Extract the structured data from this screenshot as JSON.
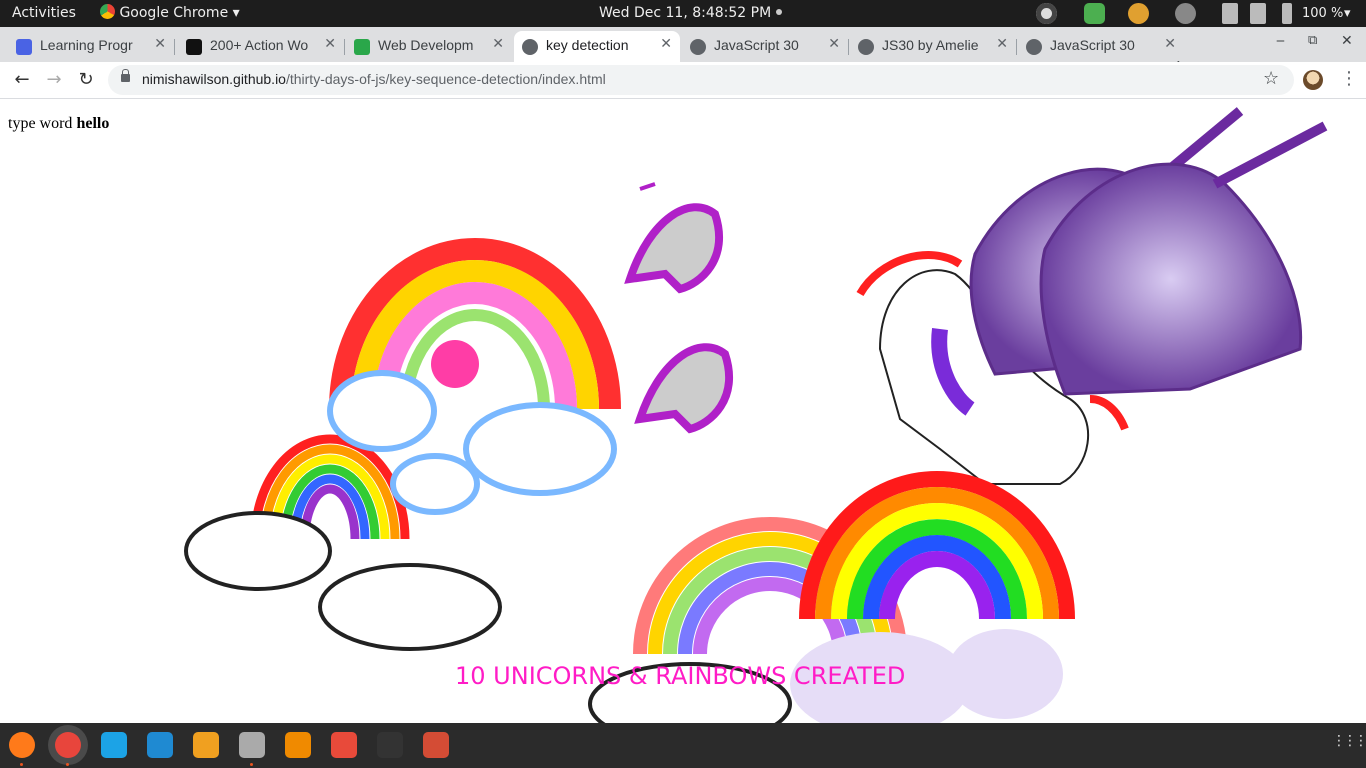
{
  "topbar": {
    "activities": "Activities",
    "app_name": "Google Chrome",
    "app_menu_arrow": "▾",
    "clock": "Wed Dec 11,  8:48:52 PM",
    "battery": "100 %",
    "system_menu_arrow": "▾"
  },
  "tabs": [
    {
      "label": "Learning Progr",
      "icon": "docs-icon",
      "color": "#4a63e4"
    },
    {
      "label": "200+ Action Wo",
      "icon": "v-logo-icon",
      "color": "#111111"
    },
    {
      "label": "Web Developm",
      "icon": "trello-icon",
      "color": "#2aa74a"
    },
    {
      "label": "key detection",
      "icon": "globe-icon",
      "color": "#5f6368",
      "active": true
    },
    {
      "label": "JavaScript 30",
      "icon": "globe-icon",
      "color": "#5f6368"
    },
    {
      "label": "JS30 by Amelie",
      "icon": "globe-icon",
      "color": "#5f6368"
    },
    {
      "label": "JavaScript 30",
      "icon": "globe-icon",
      "color": "#5f6368"
    }
  ],
  "tab_close": "✕",
  "new_tab": "+",
  "window_controls": {
    "minimize": "‒",
    "restore": "⧉",
    "close": "✕"
  },
  "toolbar": {
    "back": "←",
    "forward": "→",
    "reload": "↻",
    "url_host": "nimishawilson.github.io",
    "url_path": "/thirty-days-of-js/key-sequence-detection/index.html",
    "star": "☆",
    "menu": "⋮"
  },
  "page": {
    "instruction_prefix": "type word ",
    "instruction_word": "hello",
    "counter": "10 UNICORNS & RAINBOWS CREATED"
  },
  "dock": {
    "apps": [
      {
        "name": "firefox-icon",
        "color": "#ff7a1a"
      },
      {
        "name": "chrome-icon",
        "color": "#e8453c",
        "selected": true
      },
      {
        "name": "skype-icon",
        "color": "#1ca3e6"
      },
      {
        "name": "vscode-icon",
        "color": "#1f8ad2"
      },
      {
        "name": "blender-icon",
        "color": "#f0a020"
      },
      {
        "name": "files-icon",
        "color": "#aaaaaa"
      },
      {
        "name": "vlc-icon",
        "color": "#f08a00"
      },
      {
        "name": "git-icon",
        "color": "#e84a3a"
      },
      {
        "name": "terminal-icon",
        "color": "#333333"
      },
      {
        "name": "settings-tool-icon",
        "color": "#d44c35"
      }
    ],
    "show_apps": "⋮⋮⋮"
  },
  "colors": {
    "counter_text": "#ff1cc6",
    "topbar_bg": "#1d1d1d",
    "tabstrip_bg": "#dedfe1"
  }
}
